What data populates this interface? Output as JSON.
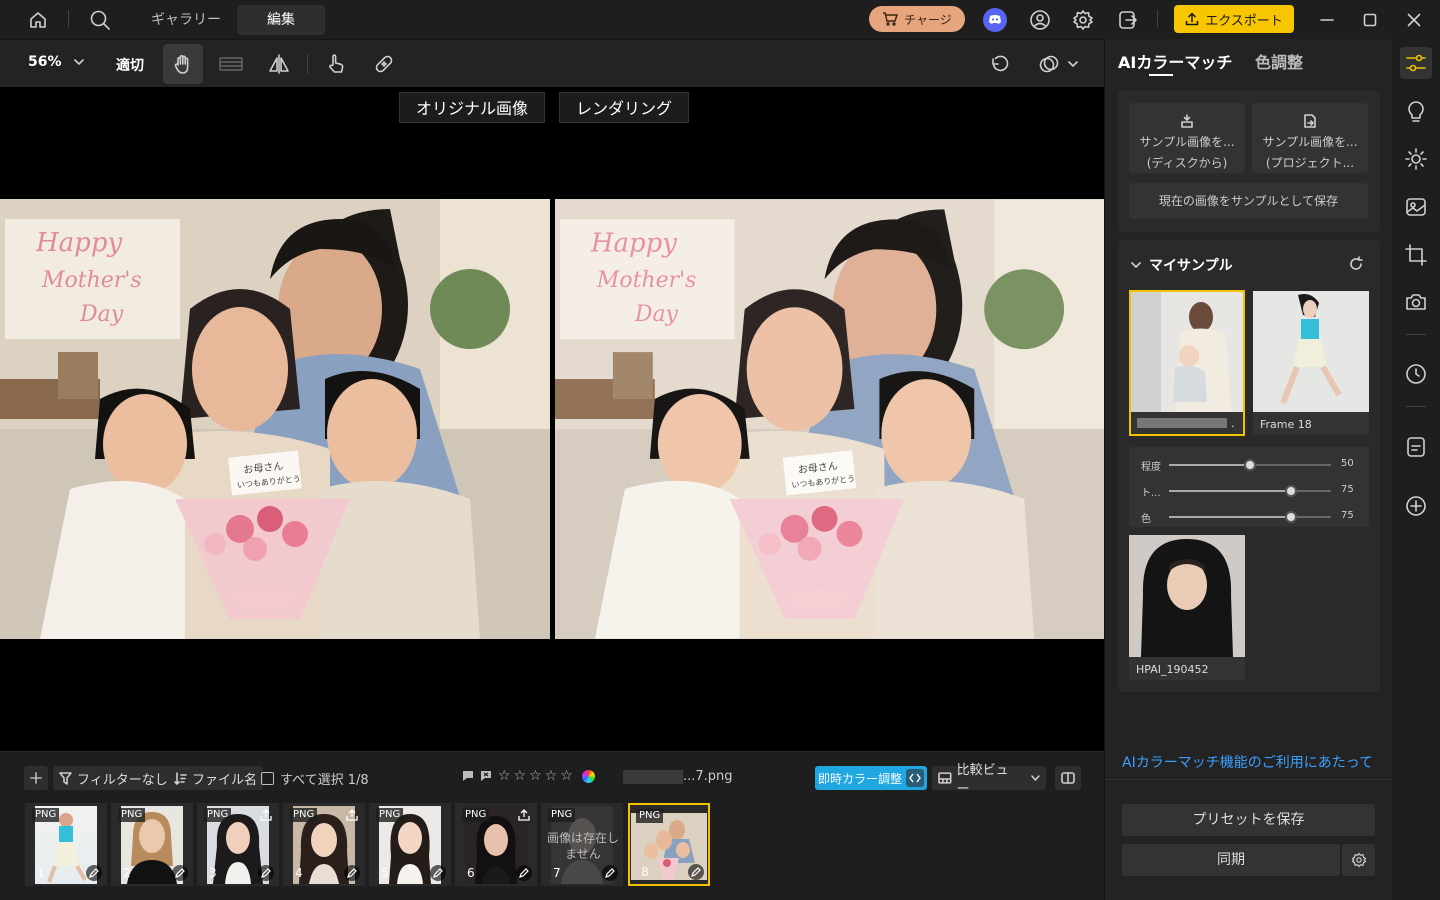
{
  "topbar": {
    "tabs": [
      {
        "label": "ギャラリー"
      },
      {
        "label": "編集"
      }
    ],
    "charge_label": "チャージ",
    "export_label": "エクスポート"
  },
  "toolbar": {
    "zoom": "56%",
    "fit_label": "適切"
  },
  "canvas": {
    "original_label": "オリジナル画像",
    "rendered_label": "レンダリング",
    "photo_text": {
      "line1": "Happy",
      "line2": "Mother's",
      "line3": "Day",
      "card1": "お母さん",
      "card2": "いつもありがとう"
    }
  },
  "bottom": {
    "filter_label": "フィルターなし",
    "sort_label": "ファイル名",
    "select_all_label": "すべて選択 1/8",
    "filename": "...7.png",
    "instant_color_label": "即時カラー調整",
    "compare_view_label": "比較ビュー"
  },
  "filmstrip": {
    "items": [
      {
        "badge": "PNG",
        "num": "1",
        "missing": ""
      },
      {
        "badge": "PNG",
        "num": "2",
        "missing": ""
      },
      {
        "badge": "PNG",
        "num": "3",
        "missing": ""
      },
      {
        "badge": "PNG",
        "num": "4",
        "missing": ""
      },
      {
        "badge": "PNG",
        "num": "5",
        "missing": ""
      },
      {
        "badge": "PNG",
        "num": "6",
        "missing": ""
      },
      {
        "badge": "PNG",
        "num": "7",
        "missing": "画像は存在しません"
      },
      {
        "badge": "PNG",
        "num": "8",
        "missing": ""
      }
    ]
  },
  "panel": {
    "tabs": [
      {
        "label": "AIカラーマッチ"
      },
      {
        "label": "色調整"
      }
    ],
    "sample_disk_line1": "サンプル画像を...",
    "sample_disk_line2": "(ディスクから)",
    "sample_project_line1": "サンプル画像を...",
    "sample_project_line2": "(プロジェクト...",
    "save_sample_label": "現在の画像をサンプルとして保存",
    "my_samples_title": "マイサンプル",
    "samples": [
      {
        "name": "."
      },
      {
        "name": "Frame 18"
      },
      {
        "name": "HPAI_190452"
      }
    ],
    "sliders": [
      {
        "label": "程度",
        "value": 50,
        "display": "50"
      },
      {
        "label": "ト...",
        "value": 75,
        "display": "75"
      },
      {
        "label": "色",
        "value": 75,
        "display": "75"
      }
    ],
    "info_link": "AIカラーマッチ機能のご利用にあたって",
    "save_preset_label": "プリセットを保存",
    "sync_label": "同期"
  },
  "colors": {
    "accent": "#f7c600",
    "link": "#3aa0ff",
    "instant": "#1ea7e0",
    "charge": "#e6a57d"
  }
}
